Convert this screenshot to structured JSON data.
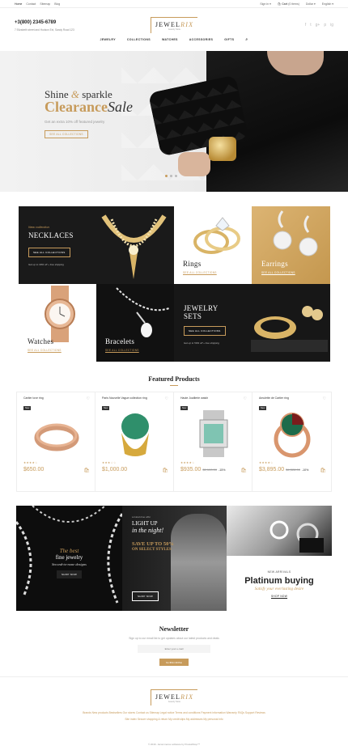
{
  "topbar": {
    "links": [
      "Home",
      "Contact",
      "Sitemap",
      "Blog"
    ],
    "sign_in": "Sign in",
    "cart_label": "Cart",
    "cart_count": "(0 items)",
    "currency": "Dollar",
    "language": "English"
  },
  "header": {
    "phone": "+3(800) 2345-6789",
    "address": "7 Elizabeth street and Hudson Ext, Sandy Road 123",
    "logo_prefix": "JEWEL",
    "logo_suffix": "RIX",
    "logo_tagline": "Jewelry Store",
    "socials": [
      "f",
      "t",
      "g+",
      "p",
      "ig"
    ],
    "nav": [
      "JEWELRY",
      "COLLECTIONS",
      "WATCHES",
      "ACCESSORIES",
      "GIFTS"
    ],
    "search_icon": "🔍"
  },
  "hero": {
    "line1_a": "Shine",
    "line1_amp": "&",
    "line1_b": "sparkle",
    "line2_a": "Clearance",
    "line2_b": "Sale",
    "subtitle": "Get an extra 10% off featured jewelry",
    "button": "SEE ALL COLLECTIONS",
    "slides": 3,
    "active_slide": 1
  },
  "categories": {
    "necklaces": {
      "kicker": "New collection",
      "title": "NECKLACES",
      "button": "SEE ALL COLLECTIONS",
      "note": "Get up to 30% off + free shipping"
    },
    "rings": {
      "title": "Rings",
      "link": "SEE ALL COLLECTIONS"
    },
    "earrings": {
      "title": "Earrings",
      "link": "SEE ALL COLLECTIONS"
    },
    "watches": {
      "title": "Watches",
      "link": "SEE ALL COLLECTIONS"
    },
    "bracelets": {
      "title": "Bracelets",
      "link": "SEE ALL COLLECTIONS"
    },
    "sets": {
      "title_1": "JEWELRY",
      "title_2": "SETS",
      "button": "SEE ALL COLLECTIONS",
      "note": "Get up to 50% off + free shipping"
    }
  },
  "featured": {
    "title": "Featured Products",
    "products": [
      {
        "name": "Cartier love ring",
        "badge": "New",
        "stars": "★★★★☆",
        "price": "$650.00",
        "old": "",
        "disc": ""
      },
      {
        "name": "Paris Nouvelle Vague collection ring",
        "badge": "New",
        "stars": "★★★☆☆",
        "price": "$1,000.00",
        "old": "",
        "disc": ""
      },
      {
        "name": "Haute Joaillerie watch",
        "badge": "New",
        "stars": "★★★★☆",
        "price": "$935.00",
        "old": "$1,100.00",
        "disc": "-15%"
      },
      {
        "name": "Amulette de Cartier ring",
        "badge": "New",
        "stars": "★★★★☆",
        "price": "$3,895.00",
        "old": "$4,328.00",
        "disc": "-10%"
      }
    ]
  },
  "banners": {
    "b1": {
      "line1": "The best",
      "line2": "fine jewelry",
      "line3": "Second-to-none designs",
      "button": "SHOP NOW"
    },
    "b2": {
      "kicker": "Limited time offer",
      "line1": "LIGHT UP",
      "line2": "in the night!",
      "sale": "SAVE UP TO 50%",
      "sale2": "ON SELECT STYLES",
      "button": "SHOP NOW"
    },
    "b3": {
      "kicker": "NEW ARRIVALS",
      "title": "Platinum buying",
      "sub": "Satisfy your everlasting desire",
      "button": "SHOP NOW"
    }
  },
  "newsletter": {
    "title": "Newsletter",
    "subtitle": "Sign up to our email list to get updates about our latest products and deals",
    "placeholder": "Enter your e-mail",
    "button": "SUBSCRIBE"
  },
  "footer": {
    "links_1": "Brands   New products   Bestsellers   Our stores   Contact us   Sitemap   Legal notice   Terms and conditions   Payment information   Warranty   FAQs   Support   Reviews",
    "links_2": "Site index   Secure shopping & return   My credit slips   My addresses   My personal info",
    "copyright": "© 2016 - Ecommerce software by PrestaShop™"
  }
}
